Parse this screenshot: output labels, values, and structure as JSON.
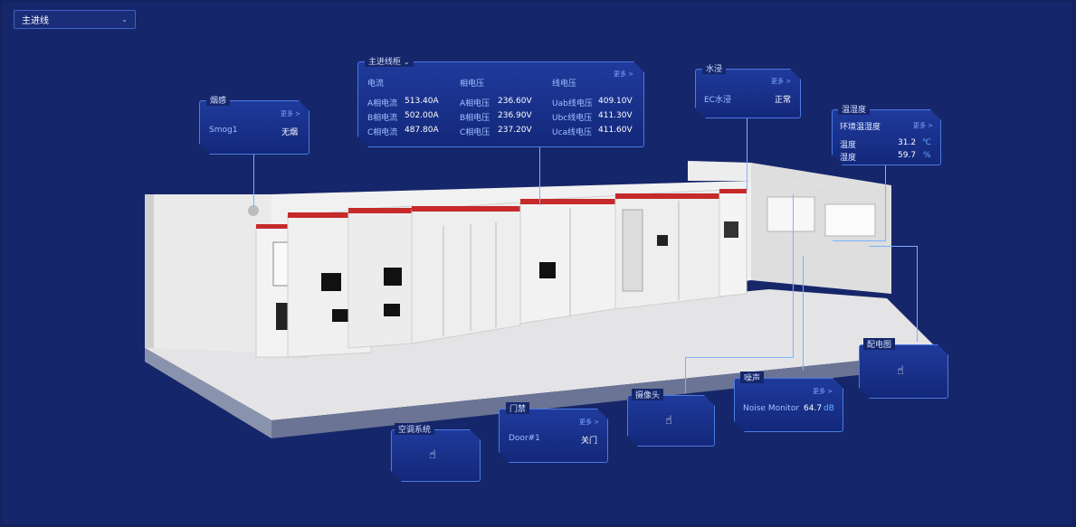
{
  "selector": {
    "value": "主进线"
  },
  "smoke": {
    "title": "烟感",
    "more": "更多 >",
    "device": "Smog1",
    "status": "无烟"
  },
  "main_cabinet": {
    "title": "主进线柜",
    "more": "更多 >",
    "headers": {
      "current": "电流",
      "phase_voltage": "相电压",
      "line_voltage": "线电压"
    },
    "rows": [
      {
        "cur_label": "A相电流",
        "cur": "513.40A",
        "pv_label": "A相电压",
        "pv": "236.60V",
        "lv_label": "Uab线电压",
        "lv": "409.10V"
      },
      {
        "cur_label": "B相电流",
        "cur": "502.00A",
        "pv_label": "B相电压",
        "pv": "236.90V",
        "lv_label": "Ubc线电压",
        "lv": "411.30V"
      },
      {
        "cur_label": "C相电流",
        "cur": "487.80A",
        "pv_label": "C相电压",
        "pv": "237.20V",
        "lv_label": "Uca线电压",
        "lv": "411.60V"
      }
    ]
  },
  "water": {
    "title": "水浸",
    "more": "更多 >",
    "device": "EC水浸",
    "status": "正常"
  },
  "temp_humidity": {
    "title": "温湿度",
    "subtitle": "环境温湿度",
    "more": "更多 >",
    "temp_label": "温度",
    "temp": "31.2",
    "temp_unit": "℃",
    "hum_label": "湿度",
    "hum": "59.7",
    "hum_unit": "%"
  },
  "distribution": {
    "title": "配电图"
  },
  "noise": {
    "title": "噪声",
    "more": "更多 >",
    "device": "Noise Monitor",
    "value": "64.7",
    "unit": "dB"
  },
  "camera": {
    "title": "摄像头"
  },
  "door": {
    "title": "门禁",
    "more": "更多 >",
    "device": "Door#1",
    "status": "关门"
  },
  "aircon": {
    "title": "空调系统"
  },
  "icons": {
    "hand": "hand-pointer-icon",
    "chevron": "chevron-down-icon"
  }
}
